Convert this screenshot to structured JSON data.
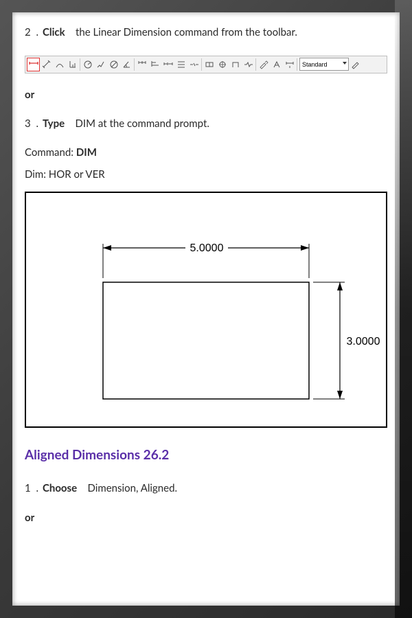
{
  "step2": {
    "num": "2 .",
    "verb": "Click",
    "rest": "the Linear Dimension command from the toolbar."
  },
  "or1": "or",
  "step3": {
    "num": "3 .",
    "verb": "Type",
    "rest": "DIM at the command prompt."
  },
  "command_line": {
    "prefix": "Command: ",
    "value": "DIM"
  },
  "dim_line": "Dim: HOR or VER",
  "toolbar": {
    "dropdown_value": "Standard"
  },
  "diagram": {
    "width_label": "5.0000",
    "height_label": "3.0000"
  },
  "section_heading": "Aligned Dimensions 26.2",
  "aligned_step1": {
    "num": "1 .",
    "verb": "Choose",
    "rest": "Dimension, Aligned."
  },
  "or2": "or"
}
